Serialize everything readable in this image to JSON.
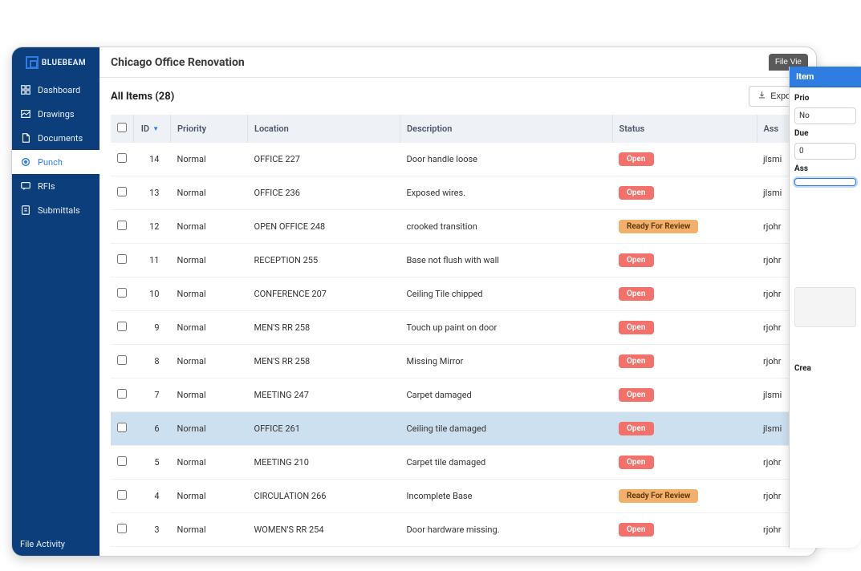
{
  "logo_text": "BLUEBEAM",
  "header": {
    "page_title": "Chicago Office Renovation",
    "file_view": "File Vie"
  },
  "sidebar": {
    "items": [
      {
        "label": "Dashboard"
      },
      {
        "label": "Drawings"
      },
      {
        "label": "Documents"
      },
      {
        "label": "Punch"
      },
      {
        "label": "RFIs"
      },
      {
        "label": "Submittals"
      }
    ],
    "footer": "File Activity"
  },
  "list": {
    "title": "All Items (28)",
    "export": "Export"
  },
  "columns": {
    "id": "ID",
    "priority": "Priority",
    "location": "Location",
    "description": "Description",
    "status": "Status",
    "assignee": "Ass"
  },
  "statuses": {
    "open": "Open",
    "review": "Ready For Review"
  },
  "rows": [
    {
      "id": "14",
      "priority": "Normal",
      "location": "OFFICE 227",
      "description": "Door handle loose",
      "status": "open",
      "assignee": "jlsmi",
      "selected": false
    },
    {
      "id": "13",
      "priority": "Normal",
      "location": "OFFICE 236",
      "description": "Exposed wires.",
      "status": "open",
      "assignee": "jlsmi",
      "selected": false
    },
    {
      "id": "12",
      "priority": "Normal",
      "location": "OPEN OFFICE 248",
      "description": "crooked transition",
      "status": "review",
      "assignee": "rjohr",
      "selected": false
    },
    {
      "id": "11",
      "priority": "Normal",
      "location": "RECEPTION 255",
      "description": "Base not flush with wall",
      "status": "open",
      "assignee": "rjohr",
      "selected": false
    },
    {
      "id": "10",
      "priority": "Normal",
      "location": "CONFERENCE 207",
      "description": "Ceiling Tile chipped",
      "status": "open",
      "assignee": "rjohr",
      "selected": false
    },
    {
      "id": "9",
      "priority": "Normal",
      "location": "MEN'S RR 258",
      "description": "Touch up paint on door",
      "status": "open",
      "assignee": "rjohr",
      "selected": false
    },
    {
      "id": "8",
      "priority": "Normal",
      "location": "MEN'S RR 258",
      "description": "Missing Mirror",
      "status": "open",
      "assignee": "rjohr",
      "selected": false
    },
    {
      "id": "7",
      "priority": "Normal",
      "location": "MEETING 247",
      "description": "Carpet damaged",
      "status": "open",
      "assignee": "jlsmi",
      "selected": false
    },
    {
      "id": "6",
      "priority": "Normal",
      "location": "OFFICE 261",
      "description": "Ceiling tile damaged",
      "status": "open",
      "assignee": "jlsmi",
      "selected": true
    },
    {
      "id": "5",
      "priority": "Normal",
      "location": "MEETING 210",
      "description": "Carpet tile damaged",
      "status": "open",
      "assignee": "rjohr",
      "selected": false
    },
    {
      "id": "4",
      "priority": "Normal",
      "location": "CIRCULATION 266",
      "description": "Incomplete Base",
      "status": "review",
      "assignee": "rjohr",
      "selected": false
    },
    {
      "id": "3",
      "priority": "Normal",
      "location": "WOMEN'S RR 254",
      "description": "Door hardware missing.",
      "status": "open",
      "assignee": "rjohr",
      "selected": false
    }
  ],
  "panel": {
    "tab": "Item",
    "priority_label": "Prio",
    "priority_value": "No",
    "due_label": "Due",
    "due_value": "0",
    "assignee_label": "Ass",
    "created_label": "Crea"
  }
}
